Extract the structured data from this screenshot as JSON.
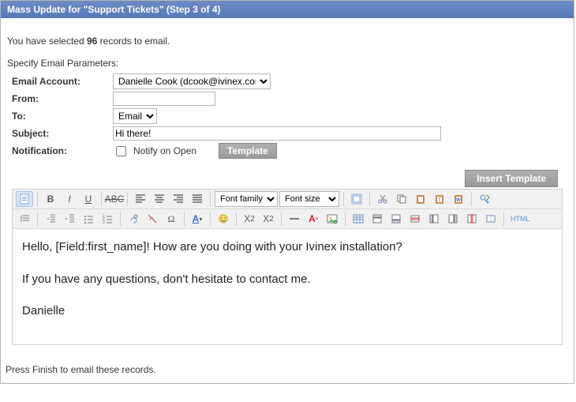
{
  "header": {
    "title": "Mass Update for \"Support Tickets\" (Step 3 of 4)"
  },
  "intro": {
    "prefix": "You have selected ",
    "count": "96",
    "suffix": " records to email."
  },
  "subhead": "Specify Email Parameters:",
  "form": {
    "account_label": "Email Account:",
    "account_value": "Danielle Cook (dcook@ivinex.com)",
    "from_label": "From:",
    "from_value": "",
    "to_label": "To:",
    "to_value": "Email",
    "subject_label": "Subject:",
    "subject_value": "Hi there!",
    "notification_label": "Notification:",
    "notify_checkbox_label": "Notify on Open",
    "template_button": "Template"
  },
  "buttons": {
    "insert_template": "Insert Template"
  },
  "toolbar": {
    "font_family_label": "Font family",
    "font_size_label": "Font size",
    "html_label": "HTML"
  },
  "editor_body": {
    "line1": "Hello, [Field:first_name]! How are you doing with your Ivinex installation?",
    "line2": "If you have any questions, don't hesitate to contact me.",
    "line3": "Danielle"
  },
  "footer": {
    "text": "Press Finish to email these records."
  }
}
